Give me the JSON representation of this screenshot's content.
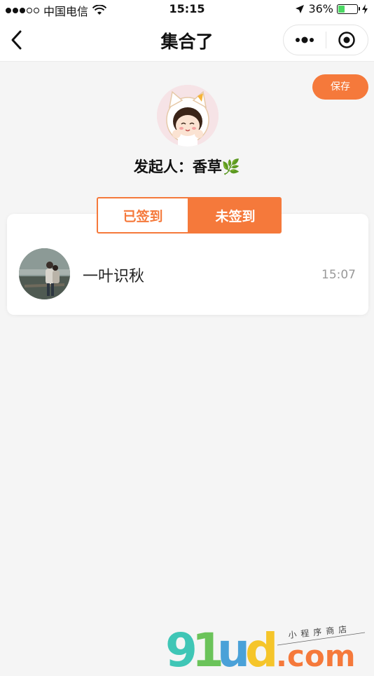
{
  "status_bar": {
    "carrier": "中国电信",
    "time": "15:15",
    "battery_percent": "36%",
    "battery_level": 0.36
  },
  "nav": {
    "title": "集合了",
    "back_icon": "chevron-left-icon",
    "more_icon": "more-dots-icon",
    "close_icon": "target-circle-icon"
  },
  "actions": {
    "save_label": "保存"
  },
  "initiator": {
    "label": "发起人：",
    "name": "香草",
    "emoji": "🌿"
  },
  "tabs": [
    {
      "label": "已签到",
      "active": false
    },
    {
      "label": "未签到",
      "active": true
    }
  ],
  "members": [
    {
      "name": "一叶识秋",
      "time": "15:07"
    }
  ],
  "watermark": {
    "text": "91ud.com",
    "sub": "小程序商店"
  },
  "colors": {
    "accent": "#f5793b",
    "background": "#f5f5f5",
    "muted_text": "#999999"
  }
}
